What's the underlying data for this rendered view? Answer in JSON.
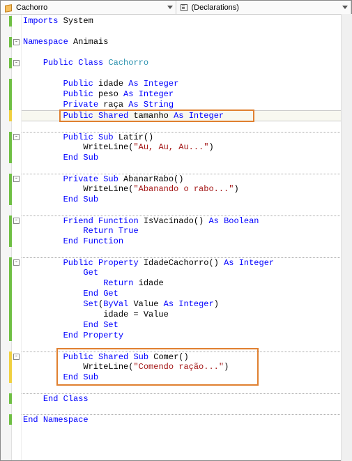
{
  "toolbar": {
    "class_dropdown": "Cachorro",
    "member_dropdown": "(Declarations)"
  },
  "code": {
    "l1": {
      "imports": "Imports",
      "system": "System"
    },
    "l3": {
      "ns": "Namespace",
      "name": "Animais"
    },
    "l5": {
      "pub": "Public",
      "class": "Class",
      "name": "Cachorro"
    },
    "l7": {
      "pub": "Public",
      "name": "idade",
      "as": "As",
      "type": "Integer"
    },
    "l8": {
      "pub": "Public",
      "name": "peso",
      "as": "As",
      "type": "Integer"
    },
    "l9": {
      "priv": "Private",
      "name": "raça",
      "as": "As",
      "type": "String"
    },
    "l10": {
      "pub": "Public",
      "shared": "Shared",
      "name": "tamanho",
      "as": "As",
      "type": "Integer"
    },
    "l12": {
      "pub": "Public",
      "sub": "Sub",
      "name": "Latir()"
    },
    "l13": {
      "write": "WriteLine(",
      "str": "\"Au, Au, Au...\"",
      "close": ")"
    },
    "l14": {
      "end": "End",
      "sub": "Sub"
    },
    "l16": {
      "priv": "Private",
      "sub": "Sub",
      "name": "AbanarRabo()"
    },
    "l17": {
      "write": "WriteLine(",
      "str": "\"Abanando o rabo...\"",
      "close": ")"
    },
    "l18": {
      "end": "End",
      "sub": "Sub"
    },
    "l20": {
      "friend": "Friend",
      "func": "Function",
      "name": "IsVacinado()",
      "as": "As",
      "type": "Boolean"
    },
    "l21": {
      "ret": "Return",
      "true": "True"
    },
    "l22": {
      "end": "End",
      "func": "Function"
    },
    "l24": {
      "pub": "Public",
      "prop": "Property",
      "name": "IdadeCachorro()",
      "as": "As",
      "type": "Integer"
    },
    "l25": {
      "get": "Get"
    },
    "l26": {
      "ret": "Return",
      "name": "idade"
    },
    "l27": {
      "end": "End",
      "get": "Get"
    },
    "l28": {
      "set": "Set",
      "byval": "ByVal",
      "val": "Value",
      "as": "As",
      "type": "Integer",
      "close": ")"
    },
    "l29": {
      "stmt": "idade = Value"
    },
    "l30": {
      "end": "End",
      "set": "Set"
    },
    "l31": {
      "end": "End",
      "prop": "Property"
    },
    "l33": {
      "pub": "Public",
      "shared": "Shared",
      "sub": "Sub",
      "name": "Comer()"
    },
    "l34": {
      "write": "WriteLine(",
      "str": "\"Comendo ração...\"",
      "close": ")"
    },
    "l35": {
      "end": "End",
      "sub": "Sub"
    },
    "l37": {
      "end": "End",
      "class": "Class"
    },
    "l39": {
      "end": "End",
      "ns": "Namespace"
    }
  }
}
